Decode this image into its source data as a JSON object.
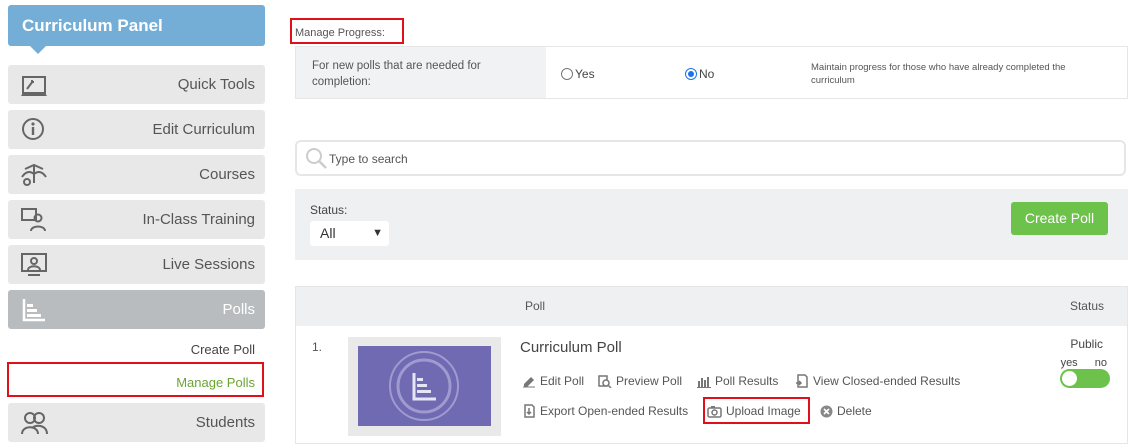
{
  "sidebar": {
    "title": "Curriculum Panel",
    "items": [
      {
        "label": "Quick Tools",
        "icon": "quick-tools-icon"
      },
      {
        "label": "Edit Curriculum",
        "icon": "info-icon"
      },
      {
        "label": "Courses",
        "icon": "courses-icon"
      },
      {
        "label": "In-Class Training",
        "icon": "in-class-training-icon"
      },
      {
        "label": "Live Sessions",
        "icon": "live-sessions-icon"
      },
      {
        "label": "Polls",
        "icon": "polls-icon"
      },
      {
        "label": "Students",
        "icon": "students-icon"
      }
    ],
    "sub": {
      "create": "Create Poll",
      "manage": "Manage Polls"
    }
  },
  "progress": {
    "title": "Manage Progress:",
    "question": "For new polls that are needed for completion:",
    "yes": "Yes",
    "no": "No",
    "selected": "No",
    "note": "Maintain progress for those who have already completed the curriculum"
  },
  "search": {
    "placeholder": "Type to search"
  },
  "filter": {
    "status_label": "Status:",
    "status_value": "All",
    "create_button": "Create Poll"
  },
  "table": {
    "col_poll": "Poll",
    "col_status": "Status",
    "rows": [
      {
        "num": "1.",
        "title": "Curriculum Poll",
        "actions": {
          "edit": "Edit Poll",
          "preview": "Preview Poll",
          "results": "Poll Results",
          "closed": "View Closed-ended Results",
          "export": "Export Open-ended Results",
          "upload": "Upload Image",
          "delete": "Delete"
        },
        "status": "Public",
        "yes": "yes",
        "no": "no"
      }
    ]
  },
  "colors": {
    "accent_blue": "#74aed6",
    "green": "#6cc24a",
    "highlight_red": "#e0101a",
    "poll_thumb": "#6f6ab1"
  }
}
